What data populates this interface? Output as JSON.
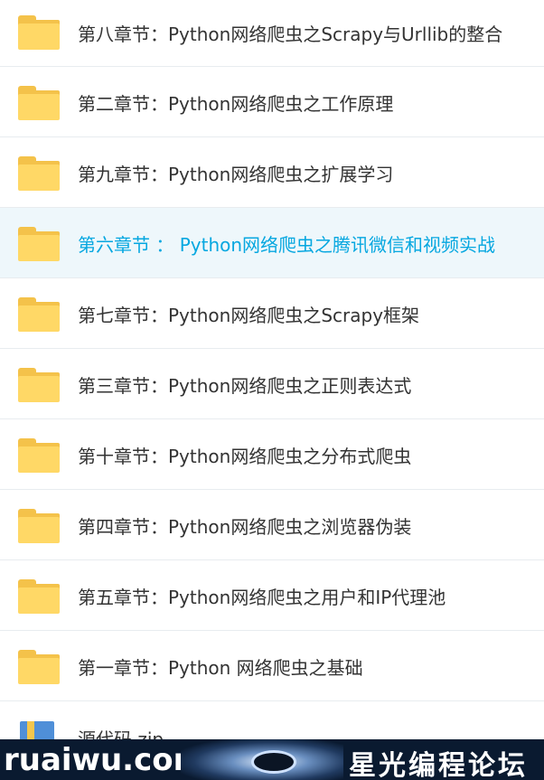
{
  "items": [
    {
      "label": "第八章节：Python网络爬虫之Scrapy与Urllib的整合"
    },
    {
      "label": "第二章节：Python网络爬虫之工作原理"
    },
    {
      "label": "第九章节：Python网络爬虫之扩展学习"
    },
    {
      "label": "第六章节 ： Python网络爬虫之腾讯微信和视频实战"
    },
    {
      "label": "第七章节：Python网络爬虫之Scrapy框架"
    },
    {
      "label": "第三章节：Python网络爬虫之正则表达式"
    },
    {
      "label": "第十章节：Python网络爬虫之分布式爬虫"
    },
    {
      "label": "第四章节：Python网络爬虫之浏览器伪装"
    },
    {
      "label": "第五章节：Python网络爬虫之用户和IP代理池"
    },
    {
      "label": "第一章节：Python 网络爬虫之基础"
    }
  ],
  "partial_item": {
    "label": "源代码.zip"
  },
  "selected_index": 3,
  "colors": {
    "selected_text": "#06a7e0",
    "selected_bg": "#eef7fb",
    "folder": "#ffd866"
  },
  "banner": {
    "brand": "ruaiwu.com",
    "forum": "星光编程论坛"
  },
  "icons": {
    "folder": "folder-icon",
    "archive": "archive-file-icon"
  }
}
